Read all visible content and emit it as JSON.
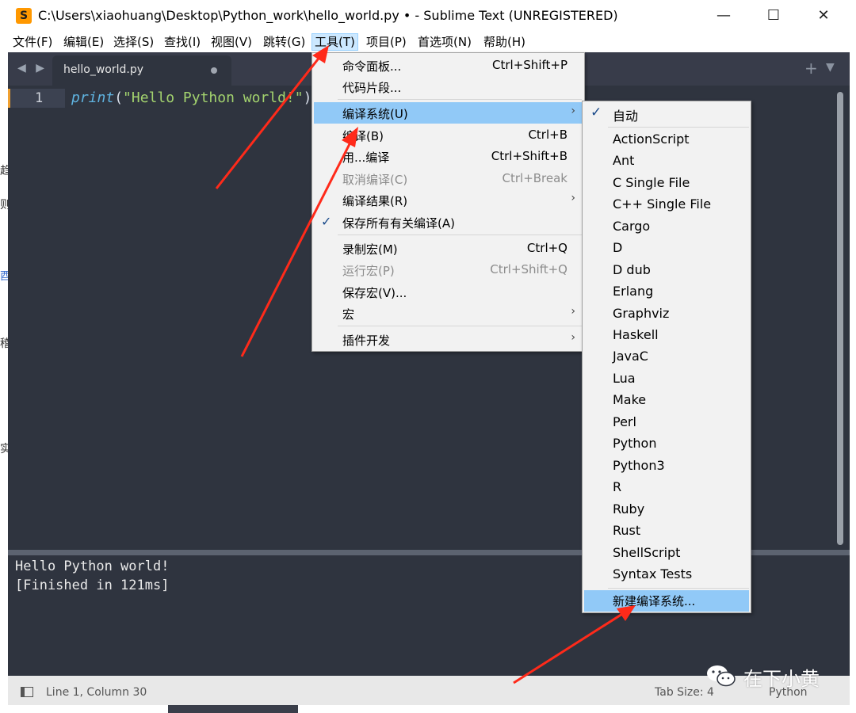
{
  "window": {
    "title": "C:\\Users\\xiaohuang\\Desktop\\Python_work\\hello_world.py • - Sublime Text (UNREGISTERED)",
    "app_icon_glyph": "S",
    "controls": {
      "minimize": "—",
      "maximize": "☐",
      "close": "✕"
    }
  },
  "menubar": {
    "items": [
      {
        "label": "文件(F)"
      },
      {
        "label": "编辑(E)"
      },
      {
        "label": "选择(S)"
      },
      {
        "label": "查找(I)"
      },
      {
        "label": "视图(V)"
      },
      {
        "label": "跳转(G)"
      },
      {
        "label": "工具(T)",
        "active": true
      },
      {
        "label": "项目(P)"
      },
      {
        "label": "首选项(N)"
      },
      {
        "label": "帮助(H)"
      }
    ]
  },
  "left_fragments": [
    "趋",
    "则",
    "酉",
    "稽",
    "实"
  ],
  "tabs": {
    "nav": "◀ ▶",
    "active_tab": "hello_world.py",
    "plus": "+",
    "dropdown": "▼"
  },
  "editor": {
    "line_number": "1",
    "code": {
      "fn": "print",
      "open": "(",
      "str": "\"Hello Python world!\"",
      "close": ")"
    }
  },
  "output": {
    "lines": [
      "Hello Python world!",
      "[Finished in 121ms]"
    ]
  },
  "statusbar": {
    "position": "Line 1, Column 30",
    "tab_size": "Tab Size: 4",
    "syntax": "Python"
  },
  "tools_menu": {
    "items": [
      {
        "label": "命令面板...",
        "shortcut": "Ctrl+Shift+P"
      },
      {
        "label": "代码片段...",
        "shortcut": ""
      },
      {
        "label": "编译系统(U)",
        "shortcut": "",
        "submenu": true,
        "highlighted": true
      },
      {
        "label": "编译(B)",
        "shortcut": "Ctrl+B"
      },
      {
        "label": "用...编译",
        "shortcut": "Ctrl+Shift+B"
      },
      {
        "label": "取消编译(C)",
        "shortcut": "Ctrl+Break",
        "disabled": true
      },
      {
        "label": "编译结果(R)",
        "shortcut": "",
        "submenu": true
      },
      {
        "label": "保存所有有关编译(A)",
        "shortcut": "",
        "checked": true
      },
      {
        "label": "录制宏(M)",
        "shortcut": "Ctrl+Q"
      },
      {
        "label": "运行宏(P)",
        "shortcut": "Ctrl+Shift+Q",
        "disabled": true
      },
      {
        "label": "保存宏(V)...",
        "shortcut": ""
      },
      {
        "label": "宏",
        "shortcut": "",
        "submenu": true
      },
      {
        "label": "插件开发",
        "shortcut": "",
        "submenu": true
      }
    ],
    "arrow_glyph": "›",
    "check_glyph": "✓"
  },
  "build_system_menu": {
    "items": [
      {
        "label": "自动",
        "checked": true
      },
      {
        "label": "ActionScript"
      },
      {
        "label": "Ant"
      },
      {
        "label": "C Single File"
      },
      {
        "label": "C++ Single File"
      },
      {
        "label": "Cargo"
      },
      {
        "label": "D"
      },
      {
        "label": "D dub"
      },
      {
        "label": "Erlang"
      },
      {
        "label": "Graphviz"
      },
      {
        "label": "Haskell"
      },
      {
        "label": "JavaC"
      },
      {
        "label": "Lua"
      },
      {
        "label": "Make"
      },
      {
        "label": "Perl"
      },
      {
        "label": "Python"
      },
      {
        "label": "Python3"
      },
      {
        "label": "R"
      },
      {
        "label": "Ruby"
      },
      {
        "label": "Rust"
      },
      {
        "label": "ShellScript"
      },
      {
        "label": "Syntax Tests"
      },
      {
        "label": "新建编译系统...",
        "highlighted": true
      }
    ]
  },
  "watermark": {
    "text": "在下小黄",
    "icon": "wechat-icon"
  },
  "annotations": {
    "arrow_color": "#ff2a1a",
    "accent_tab_marker": "#f0a030",
    "menu_highlight": "#91c9f7"
  }
}
